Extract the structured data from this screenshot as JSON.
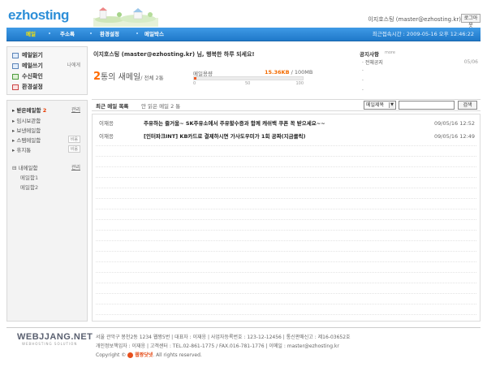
{
  "header": {
    "logo": "ezhosting",
    "user_info": "이지호스팅 (master@ezhosting.kr)",
    "logout_label": "로그아웃"
  },
  "nav": {
    "items": [
      "메일",
      "주소록",
      "환경설정",
      "메일박스"
    ],
    "last_access": "최근접속시간 : 2009-05-16 오후 12:46:22"
  },
  "sidebar": {
    "menus": [
      {
        "label": "메일읽기"
      },
      {
        "label": "메일쓰기",
        "sub": "나에게"
      },
      {
        "label": "수신확인"
      },
      {
        "label": "환경설정"
      }
    ],
    "folders": {
      "inbox": {
        "label": "받은메일함",
        "count": "2",
        "action": "관리"
      },
      "temp": "임시보관함",
      "sent": "보낸메일함",
      "spam": {
        "label": "스팸메일함",
        "button": "비움"
      },
      "trash": {
        "label": "휴지통",
        "button": "비움"
      },
      "mybox": {
        "label": "내메일함",
        "action": "관리"
      },
      "sub": [
        "메일함1",
        "메일함2"
      ]
    }
  },
  "main": {
    "welcome": "이지호스팅 (master@ezhosting.kr) 님, 행복한 하루 되세요!",
    "new_mail_count": "2",
    "new_mail_label": "통의 새메일",
    "total_label": "/ 전체 2통",
    "quota": {
      "label": "메일용량",
      "used": "15.36KB",
      "total": "/ 100MB",
      "used_fraction": 0.02,
      "ticks": [
        "0",
        "50",
        "100"
      ]
    },
    "notice": {
      "title": "공지사항",
      "more": "more",
      "items": [
        "· 전체공지",
        "·",
        "·",
        "·"
      ],
      "date": "05/06"
    },
    "tabs": [
      "최근 메일 목록",
      "안 읽은 메일 2 통"
    ],
    "search": {
      "select_value": "메일제목",
      "button": "검색"
    },
    "mails": [
      {
        "sender": "이재응",
        "subject": "주유하는 즐거움~ SK주유소에서 주유할수증과 함께 캐쉬백 쿠폰 꼭 받으세요~~",
        "date": "09/05/16 12:52"
      },
      {
        "sender": "이재응",
        "subject": "[인터파크INT] KB카드로 결제하시면 가사도우미가 1회 공짜(지금클릭)",
        "date": "09/05/16 12:49"
      }
    ]
  },
  "footer": {
    "logo": "WEBJJANG.NET",
    "logo_sub": "WEBHOSTING SOLUTION",
    "line1": "서울 관악구 봉천2동 1234   웹짱5번   |   대표자 : 이재응   |   사업자등록번호 : 123-12-12456   |   통신판매신고 : 제16-03652호",
    "line2": "개인정보책임자 : 이재응   |   고객센터 : TEL.02-861-1775 / FAX.016-781-1776   |   이메일 : master@ezhosting.kr",
    "copy_prefix": "Copyright ©",
    "brand": "웹짱닷넷",
    "copy_suffix": ". All rights reserved."
  },
  "colors": {
    "nav_blue": "#2a86d8",
    "accent_orange": "#ff6a00",
    "logo_blue": "#2e8fd8"
  }
}
